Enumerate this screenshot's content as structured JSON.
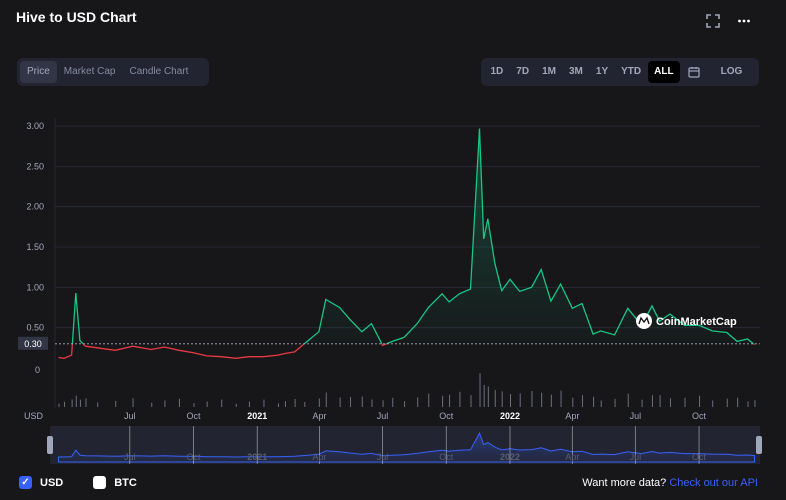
{
  "title": "Hive to USD Chart",
  "icons": {
    "fullscreen": "fullscreen-icon",
    "more": "more-icon",
    "calendar": "calendar-icon"
  },
  "tabs": [
    {
      "label": "Price",
      "active": true
    },
    {
      "label": "Market Cap",
      "active": false
    },
    {
      "label": "Candle Chart",
      "active": false
    }
  ],
  "ranges": [
    {
      "label": "1D",
      "active": false
    },
    {
      "label": "7D",
      "active": false
    },
    {
      "label": "1M",
      "active": false
    },
    {
      "label": "3M",
      "active": false
    },
    {
      "label": "1Y",
      "active": false
    },
    {
      "label": "YTD",
      "active": false
    },
    {
      "label": "ALL",
      "active": true
    }
  ],
  "log_label": "LOG",
  "watermark": "CoinMarketCap",
  "legend": [
    {
      "label": "USD",
      "checked": true
    },
    {
      "label": "BTC",
      "checked": false
    }
  ],
  "footer": {
    "text": "Want more data?",
    "link": "Check out our API"
  },
  "colors": {
    "up": "#16c784",
    "down": "#ea3943",
    "accent": "#3861fb",
    "background": "#17171a"
  },
  "chart_data": {
    "type": "line",
    "baseline_value": 0.3,
    "baseline_label": "0.30",
    "volume_axis_label": "0",
    "x_axis_currency_label": "USD",
    "ylim": [
      0,
      3.1
    ],
    "yticks": [
      0.5,
      1.0,
      1.5,
      2.0,
      2.5,
      3.0
    ],
    "ytick_labels": [
      "0.50",
      "1.00",
      "1.50",
      "2.00",
      "2.50",
      "3.00"
    ],
    "xticks": [
      "Jul",
      "Oct",
      "2021",
      "Apr",
      "Jul",
      "Oct",
      "2022",
      "Apr",
      "Jul",
      "Oct"
    ],
    "series": [
      {
        "x": [
          "2020-03-20",
          "2020-03-28",
          "2020-04-08",
          "2020-04-14",
          "2020-04-20",
          "2020-04-28",
          "2020-05-15",
          "2020-06-10",
          "2020-07-05",
          "2020-08-01",
          "2020-08-20",
          "2020-09-10",
          "2020-10-01",
          "2020-10-20",
          "2020-11-10",
          "2020-12-01",
          "2020-12-20",
          "2021-01-10",
          "2021-01-31",
          "2021-02-10",
          "2021-02-24",
          "2021-03-10",
          "2021-03-31",
          "2021-04-10",
          "2021-04-30",
          "2021-05-15",
          "2021-06-01",
          "2021-06-15",
          "2021-07-01",
          "2021-07-15",
          "2021-08-01",
          "2021-08-20",
          "2021-09-05",
          "2021-09-25",
          "2021-10-05",
          "2021-10-20",
          "2021-11-05",
          "2021-11-18",
          "2021-11-24",
          "2021-11-30",
          "2021-12-10",
          "2021-12-20",
          "2022-01-01",
          "2022-01-15",
          "2022-02-01",
          "2022-02-15",
          "2022-03-01",
          "2022-03-15",
          "2022-04-01",
          "2022-04-15",
          "2022-05-01",
          "2022-05-12",
          "2022-06-01",
          "2022-06-20",
          "2022-07-10",
          "2022-07-25",
          "2022-08-05",
          "2022-08-20",
          "2022-09-10",
          "2022-10-01",
          "2022-10-20",
          "2022-11-10",
          "2022-11-25",
          "2022-12-10",
          "2022-12-20"
        ],
        "values": [
          0.13,
          0.12,
          0.16,
          0.93,
          0.34,
          0.27,
          0.25,
          0.22,
          0.27,
          0.23,
          0.26,
          0.22,
          0.19,
          0.15,
          0.14,
          0.12,
          0.14,
          0.14,
          0.16,
          0.18,
          0.2,
          0.3,
          0.45,
          0.85,
          0.75,
          0.6,
          0.45,
          0.55,
          0.28,
          0.33,
          0.38,
          0.55,
          0.75,
          0.92,
          0.82,
          0.92,
          0.98,
          2.97,
          1.6,
          1.85,
          1.3,
          0.96,
          1.1,
          0.95,
          1.0,
          1.22,
          0.83,
          1.04,
          0.74,
          0.8,
          0.42,
          0.46,
          0.41,
          0.74,
          0.53,
          0.77,
          0.58,
          0.67,
          0.53,
          0.53,
          0.46,
          0.44,
          0.33,
          0.36,
          0.29
        ]
      }
    ]
  }
}
